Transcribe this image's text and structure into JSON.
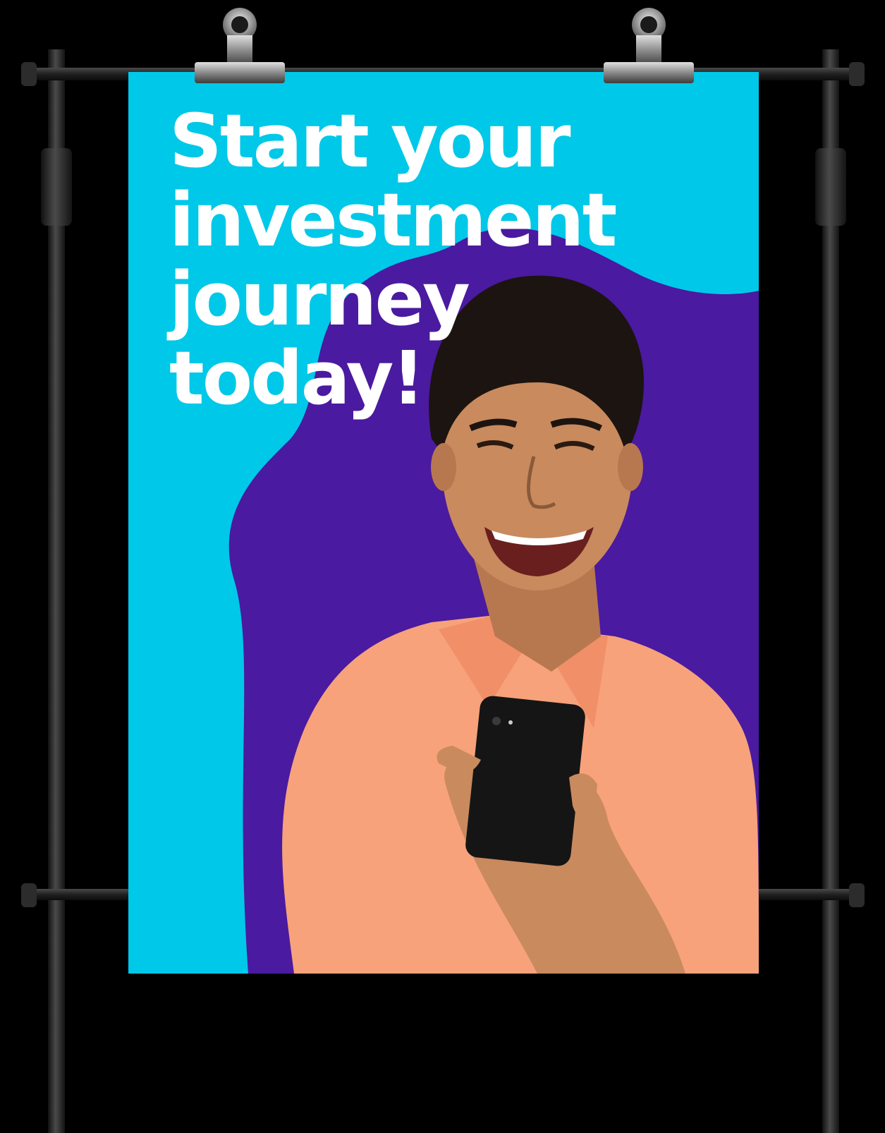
{
  "poster": {
    "headline_lines": [
      "Start your",
      "investment",
      "journey",
      "today!"
    ],
    "colors": {
      "background": "#00c8e8",
      "blob": "#4a1aa0",
      "text": "#ffffff",
      "shirt": "#f7a27a",
      "stand": "#2a2a2a"
    }
  },
  "icons": [
    "binder-clip-icon",
    "binder-clip-icon",
    "smartphone-icon"
  ]
}
